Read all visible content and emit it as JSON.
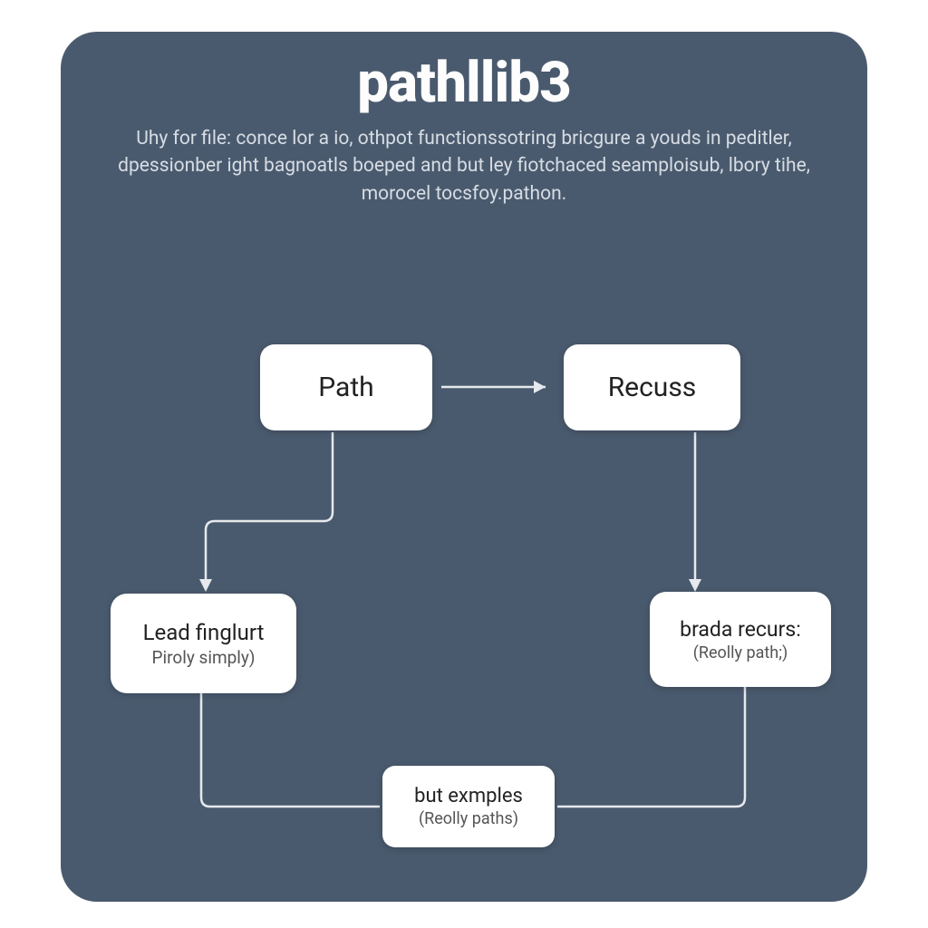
{
  "header": {
    "title": "pathllib3",
    "subtitle": "Uhy for file: conce lor a io, othpot functionssotring bricgure a youds in peditler, dpessionber ight bagnoatls boeped and but ley fiotchaced seamploisub, lbory tihe, morocel tocsfoy.pathon."
  },
  "nodes": {
    "path": {
      "label": "Path"
    },
    "recuss": {
      "label": "Recuss"
    },
    "lead": {
      "label": "Lead finglurt",
      "sub": "Piroly simply)"
    },
    "brada": {
      "label": "brada recurs:",
      "sub": "(Reolly path;)"
    },
    "but": {
      "label": "but exmples",
      "sub": "(Reolly paths)"
    }
  },
  "colors": {
    "card_bg": "#4a5a6e",
    "node_bg": "#ffffff",
    "line": "#e6e9ed"
  }
}
